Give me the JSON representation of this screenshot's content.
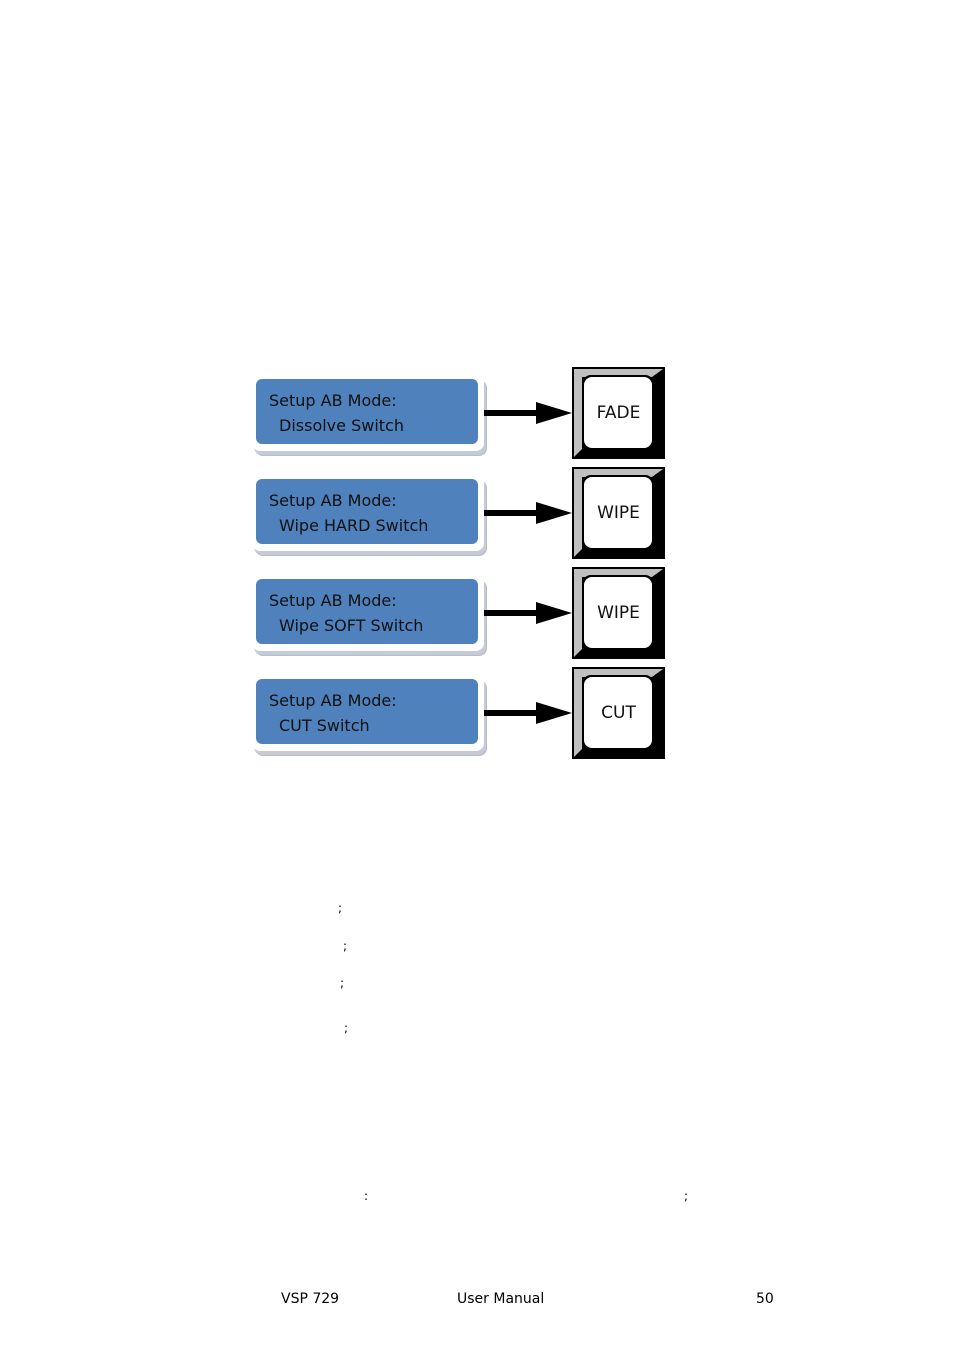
{
  "diagram": {
    "rows": [
      {
        "line1": "Setup AB Mode:",
        "line2": "Dissolve Switch",
        "key": "FADE"
      },
      {
        "line1": "Setup AB Mode:",
        "line2": "Wipe HARD Switch",
        "key": "WIPE"
      },
      {
        "line1": "Setup AB Mode:",
        "line2": "Wipe SOFT Switch",
        "key": "WIPE"
      },
      {
        "line1": "Setup AB Mode:",
        "line2": "CUT Switch",
        "key": "CUT"
      }
    ],
    "colors": {
      "lcd": "#4f81bd",
      "bevel_light": "#c0c0c0",
      "key_face": "#ffffff"
    }
  },
  "body_marks": {
    "list_semicolons": [
      ";",
      ";",
      ";",
      ";"
    ],
    "bottom_marks": [
      ":",
      ";"
    ]
  },
  "footer": {
    "model": "VSP 729",
    "title": "User Manual",
    "page": "50"
  }
}
